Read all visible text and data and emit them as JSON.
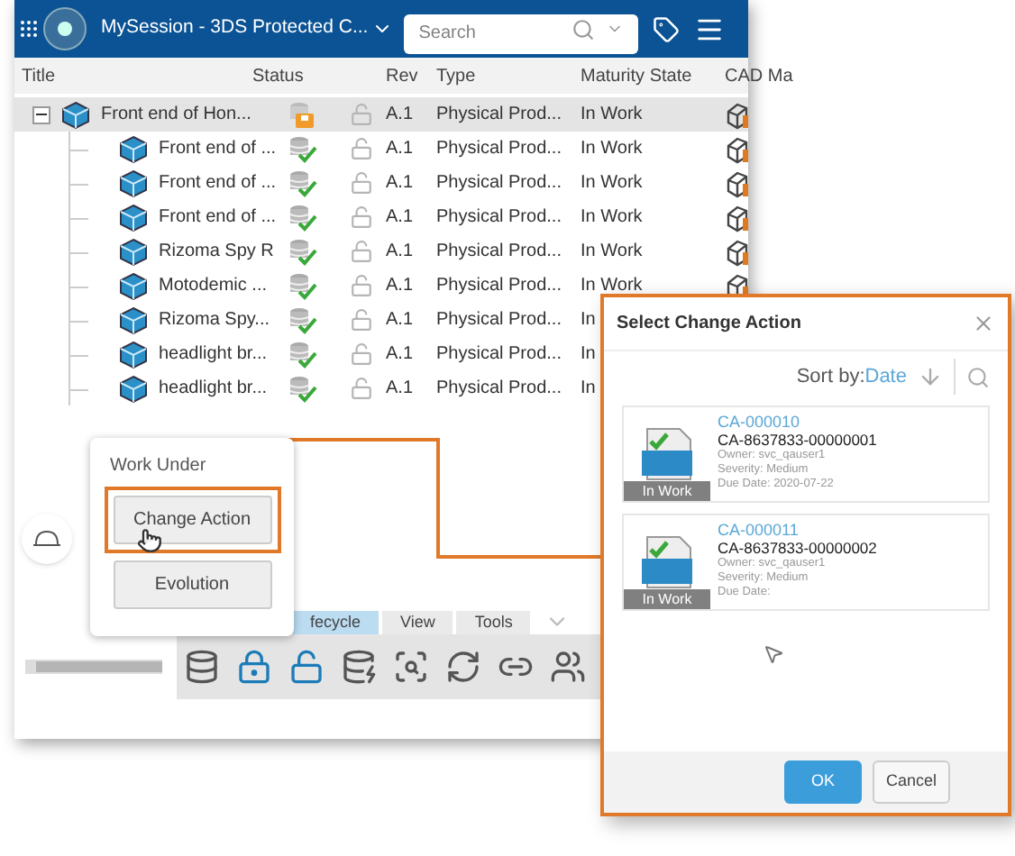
{
  "header": {
    "title": "MySession - 3DS Protected C...",
    "search": {
      "placeholder": "Search"
    }
  },
  "table": {
    "columns": [
      "Title",
      "Status",
      "Rev",
      "Type",
      "Maturity State",
      "CAD Ma"
    ],
    "rows": [
      {
        "title": "Front end of Hon...",
        "kind": "reserved",
        "rev": "A.1",
        "type": "Physical Prod...",
        "maturity": "In Work",
        "cad_model": true,
        "expanded": true,
        "selected": true,
        "children": [
          {
            "title": "Front end of ...",
            "kind": "saved",
            "rev": "A.1",
            "type": "Physical Prod...",
            "maturity": "In Work",
            "cad_model": true,
            "selected": false
          },
          {
            "title": "Front end of ...",
            "kind": "saved",
            "rev": "A.1",
            "type": "Physical Prod...",
            "maturity": "In Work",
            "cad_model": true,
            "selected": false
          },
          {
            "title": "Front end of ...",
            "kind": "saved",
            "rev": "A.1",
            "type": "Physical Prod...",
            "maturity": "In Work",
            "cad_model": true,
            "selected": false
          },
          {
            "title": "Rizoma Spy R",
            "kind": "saved",
            "rev": "A.1",
            "type": "Physical Prod...",
            "maturity": "In Work",
            "cad_model": true,
            "selected": false
          },
          {
            "title": "Motodemic ...",
            "kind": "saved",
            "rev": "A.1",
            "type": "Physical Prod...",
            "maturity": "In Work",
            "cad_model": true,
            "selected": false
          },
          {
            "title": "Rizoma Spy...",
            "kind": "saved",
            "rev": "A.1",
            "type": "Physical Prod...",
            "maturity": "In",
            "selected": false
          },
          {
            "title": "headlight br...",
            "kind": "saved",
            "rev": "A.1",
            "type": "Physical Prod...",
            "maturity": "In",
            "selected": false
          },
          {
            "title": "headlight br...",
            "kind": "saved",
            "rev": "A.1",
            "type": "Physical Prod...",
            "maturity": "In",
            "selected": false
          }
        ]
      }
    ]
  },
  "popover": {
    "title": "Work Under",
    "buttons": [
      {
        "label": "Change Action",
        "highlighted": true
      },
      {
        "label": "Evolution",
        "highlighted": false
      }
    ]
  },
  "bottom_tabs": [
    {
      "label": "fecycle",
      "selected": true
    },
    {
      "label": "View",
      "selected": false
    },
    {
      "label": "Tools",
      "selected": false
    }
  ],
  "dialog": {
    "title": "Select Change Action",
    "sort_label": "Sort by:",
    "sort_value": "Date",
    "items": [
      {
        "id": "CA-000010",
        "name": "CA-8637833-00000001",
        "owner": "Owner: svc_qauser1",
        "severity": "Severity: Medium",
        "due": "Due Date: 2020-07-22",
        "state": "In Work"
      },
      {
        "id": "CA-000011",
        "name": "CA-8637833-00000002",
        "owner": "Owner: svc_qauser1",
        "severity": "Severity: Medium",
        "due": "Due Date:",
        "state": "In Work"
      }
    ],
    "buttons": [
      "OK",
      "Cancel"
    ]
  }
}
